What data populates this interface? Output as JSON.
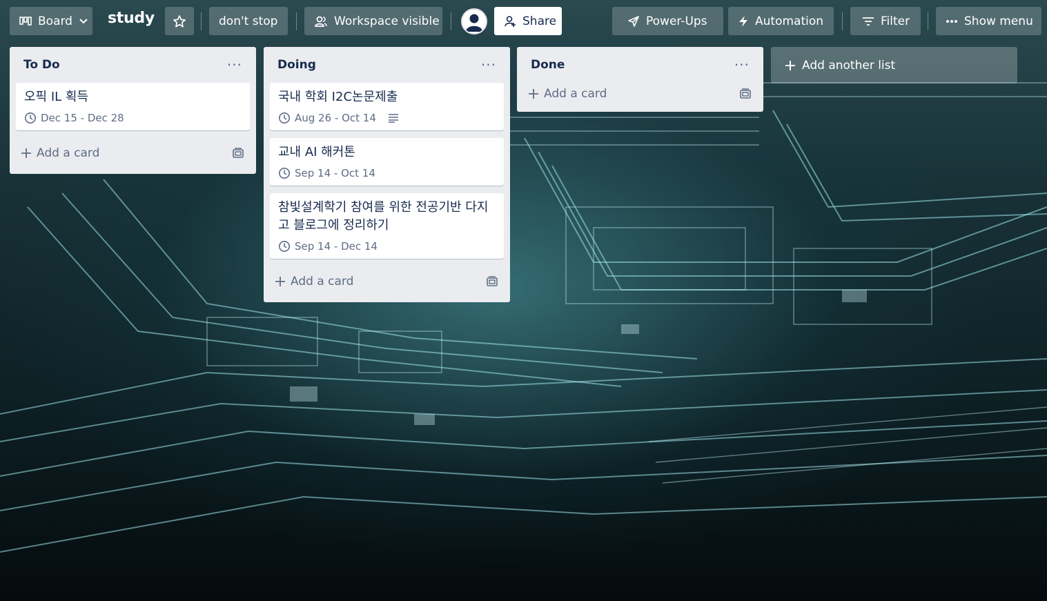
{
  "header": {
    "view_switcher_label": "Board",
    "board_title": "study",
    "workspace_label": "don't stop",
    "visibility_label": "Workspace visible",
    "share_label": "Share",
    "powerups_label": "Power-Ups",
    "automation_label": "Automation",
    "filter_label": "Filter",
    "show_menu_label": "Show menu"
  },
  "lists": [
    {
      "title": "To Do",
      "menu_glyph": "···",
      "add_card_label": "Add a card",
      "cards": [
        {
          "title": "오픽 IL 획득",
          "date": "Dec 15 - Dec 28",
          "has_description": false
        }
      ]
    },
    {
      "title": "Doing",
      "menu_glyph": "···",
      "add_card_label": "Add a card",
      "cards": [
        {
          "title": "국내 학회 I2C논문제출",
          "date": "Aug 26 - Oct 14",
          "has_description": true
        },
        {
          "title": "교내 AI 해커톤",
          "date": "Sep 14 - Oct 14",
          "has_description": false
        },
        {
          "title": "참빛설계학기 참여를 위한 전공기반 다지고 블로그에 정리하기",
          "date": "Sep 14 - Dec 14",
          "has_description": false
        }
      ]
    },
    {
      "title": "Done",
      "menu_glyph": "···",
      "add_card_label": "Add a card",
      "cards": []
    }
  ],
  "add_list_label": "Add another list",
  "colors": {
    "list_bg": "#ebecf0",
    "text_primary": "#172b4d",
    "text_secondary": "#5e6c84",
    "header_button_bg": "rgba(255,255,255,0.20)"
  },
  "icons": {
    "view_switcher": "board-icon",
    "view_dropdown": "chevron-down-icon",
    "star": "star-icon",
    "visibility": "people-icon",
    "share": "add-person-icon",
    "powerups": "rocket-icon",
    "automation": "lightning-icon",
    "filter": "filter-icon",
    "show_menu": "more-icon",
    "card_date": "clock-icon",
    "card_description": "description-icon",
    "add": "plus-icon",
    "template": "card-template-icon"
  }
}
